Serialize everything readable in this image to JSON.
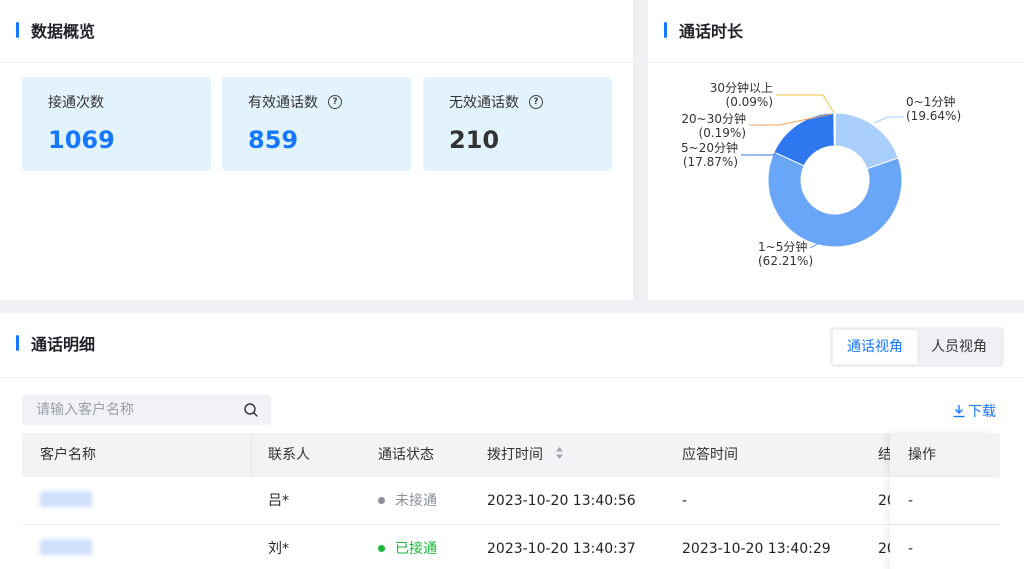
{
  "overview": {
    "title": "数据概览",
    "stats": [
      {
        "label": "接通次数",
        "value": "1069",
        "color": "#1677ff",
        "help": false
      },
      {
        "label": "有效通话数",
        "value": "859",
        "color": "#1677ff",
        "help": true
      },
      {
        "label": "无效通话数",
        "value": "210",
        "color": "#333333",
        "help": true
      }
    ]
  },
  "duration": {
    "title": "通话时长",
    "chart_data": {
      "type": "pie",
      "variant": "donut",
      "slices": [
        {
          "label": "0~1分钟",
          "pct_label": "(19.64%)",
          "value": 19.64,
          "color": "#a9cefb"
        },
        {
          "label": "1~5分钟",
          "pct_label": "(62.21%)",
          "value": 62.21,
          "color": "#6aa6f8"
        },
        {
          "label": "5~20分钟",
          "pct_label": "(17.87%)",
          "value": 17.87,
          "color": "#2f77ef"
        },
        {
          "label": "20~30分钟",
          "pct_label": "(0.19%)",
          "value": 0.19,
          "color": "#f5a35a"
        },
        {
          "label": "30分钟以上",
          "pct_label": "(0.09%)",
          "value": 0.09,
          "color": "#f5c44a"
        }
      ]
    }
  },
  "detail": {
    "title": "通话明细",
    "views": [
      "通话视角",
      "人员视角"
    ],
    "search_placeholder": "请输入客户名称",
    "download_label": "下载",
    "columns": [
      "客户名称",
      "联系人",
      "通话状态",
      "拨打时间",
      "应答时间",
      "结",
      "操作"
    ],
    "rows": [
      {
        "contact": "吕*",
        "status": "未接通",
        "status_color": "#8a9099",
        "status_text_color": "#8a9099",
        "dial_time": "2023-10-20 13:40:56",
        "answer_time": "-",
        "end": "20",
        "op": "-"
      },
      {
        "contact": "刘*",
        "status": "已接通",
        "status_color": "#1db83a",
        "status_text_color": "#1db83a",
        "dial_time": "2023-10-20 13:40:37",
        "answer_time": "2023-10-20 13:40:29",
        "end": "20",
        "op": "-"
      }
    ]
  }
}
